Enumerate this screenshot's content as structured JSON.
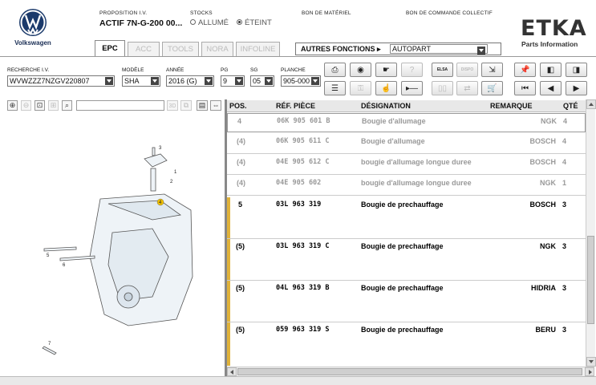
{
  "brand": {
    "vw_label": "Volkswagen",
    "etka_title": "ETKA",
    "etka_sub": "Parts Information"
  },
  "header": {
    "proposition_label": "PROPOSITION I.V.",
    "proposition_value": "ACTIF  7N-G-200 00...",
    "stocks_label": "STOCKS",
    "stocks_on": "ALLUMÉ",
    "stocks_off": "ÉTEINT",
    "bon_materiel": "BON DE MATÉRIEL",
    "bon_commande": "BON DE COMMANDE COLLECTIF"
  },
  "tabs": [
    {
      "label": "EPC",
      "active": true
    },
    {
      "label": "ACC",
      "active": false
    },
    {
      "label": "TOOLS",
      "active": false
    },
    {
      "label": "NORA",
      "active": false
    },
    {
      "label": "INFOLINE",
      "active": false
    }
  ],
  "autres": {
    "label": "AUTRES FONCTIONS ▸",
    "value": "AUTOPART"
  },
  "search": {
    "vin_label": "RECHERCHE I.V.",
    "vin_value": "WVWZZZ7NZGV220807",
    "modele_label": "MODÈLE",
    "modele_value": "SHA",
    "annee_label": "ANNÉE",
    "annee_value": "2016 (G)",
    "pg_label": "PG",
    "pg_value": "9",
    "sg_label": "SG",
    "sg_value": "05",
    "planche_label": "PLANCHE",
    "planche_value": "905-000"
  },
  "toolbar": {
    "elsa_label": "ELSA",
    "dispo_label": "DISPO"
  },
  "diagram": {
    "callouts": [
      "3",
      "1",
      "2",
      "4",
      "5",
      "6",
      "7"
    ]
  },
  "table": {
    "headers": {
      "pos": "POS.",
      "ref": "RÉF. PIÈCE",
      "designation": "DÉSIGNATION",
      "remarque": "REMARQUE",
      "qte": "QTÉ"
    },
    "rows": [
      {
        "pos": "4",
        "ref": "06K  905  601  B",
        "designation": "Bougie d'allumage",
        "remarque": "NGK",
        "qte": "4"
      },
      {
        "pos": "(4)",
        "ref": "06K  905  611  C",
        "designation": "Bougie d'allumage",
        "remarque": "BOSCH",
        "qte": "4"
      },
      {
        "pos": "(4)",
        "ref": "04E  905  612  C",
        "designation": "bougie d'allumage longue duree",
        "remarque": "BOSCH",
        "qte": "4"
      },
      {
        "pos": "(4)",
        "ref": "04E  905  602",
        "designation": "bougie d'allumage longue duree",
        "remarque": "NGK",
        "qte": "1"
      },
      {
        "pos": "5",
        "ref": "03L  963  319",
        "designation": "Bougie de prechauffage",
        "remarque": "BOSCH",
        "qte": "3"
      },
      {
        "pos": "(5)",
        "ref": "03L  963  319  C",
        "designation": "Bougie de prechauffage",
        "remarque": "NGK",
        "qte": "3"
      },
      {
        "pos": "(5)",
        "ref": "04L  963  319  B",
        "designation": "Bougie de prechauffage",
        "remarque": "HIDRIA",
        "qte": "3"
      },
      {
        "pos": "(5)",
        "ref": "059  963  319  S",
        "designation": "Bougie de prechauffage",
        "remarque": "BERU",
        "qte": "3"
      }
    ]
  }
}
